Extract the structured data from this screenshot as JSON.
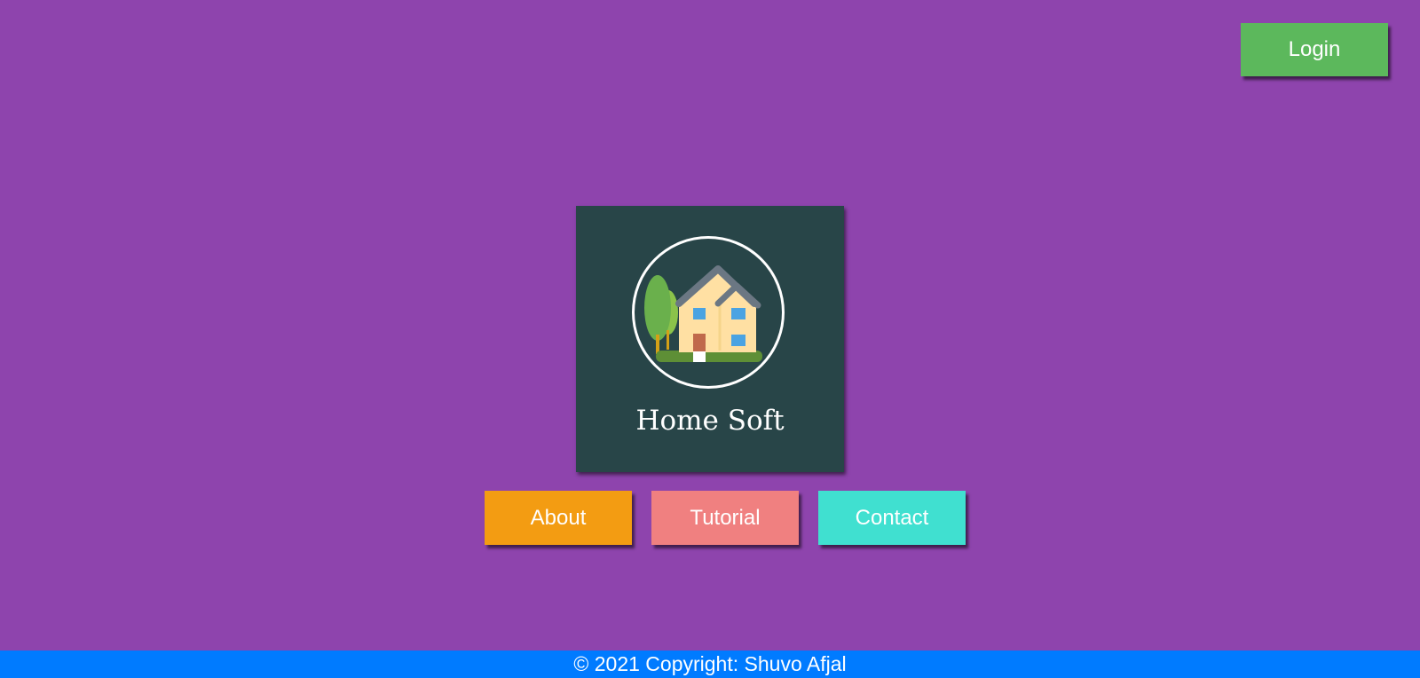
{
  "header": {
    "login_label": "Login"
  },
  "brand": {
    "logo_icon": "house-icon",
    "name": "Home Soft"
  },
  "nav": {
    "about_label": "About",
    "tutorial_label": "Tutorial",
    "contact_label": "Contact"
  },
  "footer": {
    "copyright_text": "© 2021 Copyright: Shuvo Afjal"
  },
  "colors": {
    "background": "#8e44ad",
    "login": "#5cb85c",
    "card": "#284548",
    "about": "#f39c12",
    "tutorial": "#f08080",
    "contact": "#40e0d0",
    "footer": "#007bff"
  }
}
